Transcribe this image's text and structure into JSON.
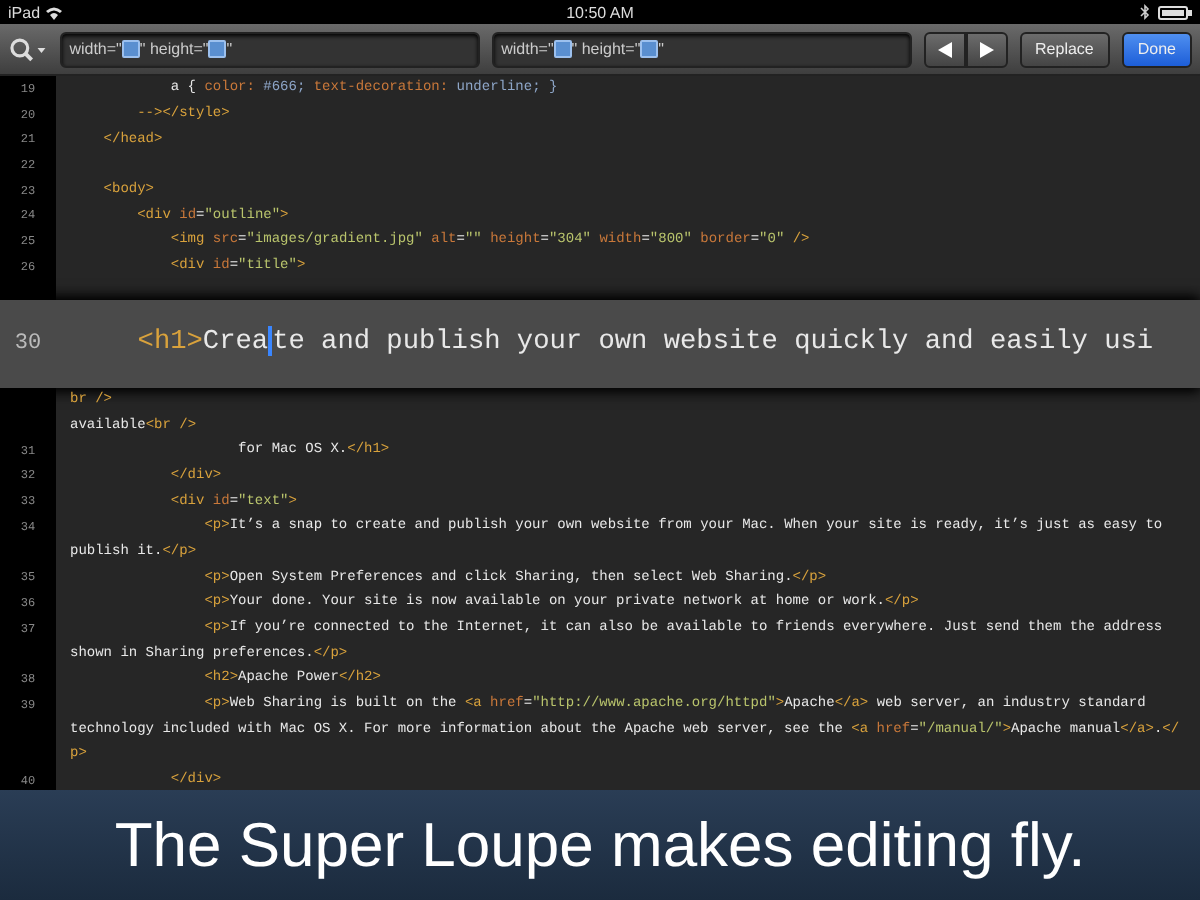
{
  "status_bar": {
    "device": "iPad",
    "time": "10:50 AM"
  },
  "toolbar": {
    "find_field": {
      "segments": [
        {
          "kind": "text",
          "text": "width=\""
        },
        {
          "kind": "token"
        },
        {
          "kind": "text",
          "text": "\" height=\""
        },
        {
          "kind": "token"
        },
        {
          "kind": "text",
          "text": "\""
        }
      ]
    },
    "replace_field": {
      "segments": [
        {
          "kind": "text",
          "text": "width=\""
        },
        {
          "kind": "token"
        },
        {
          "kind": "text",
          "text": "\" height=\""
        },
        {
          "kind": "token"
        },
        {
          "kind": "text",
          "text": "\""
        }
      ]
    },
    "replace_button": "Replace",
    "done_button": "Done"
  },
  "editor": {
    "lines_before": [
      {
        "number": "19",
        "segments": [
          {
            "kind": "text",
            "text": "            a { "
          },
          {
            "kind": "attr",
            "text": "color:"
          },
          {
            "kind": "value",
            "text": " #666; "
          },
          {
            "kind": "attr",
            "text": "text-decoration:"
          },
          {
            "kind": "value",
            "text": " underline; }"
          }
        ]
      },
      {
        "number": "20",
        "segments": [
          {
            "kind": "tag",
            "text": "        --></style>"
          }
        ]
      },
      {
        "number": "21",
        "segments": [
          {
            "kind": "tag",
            "text": "    </head>"
          }
        ]
      },
      {
        "number": "22"
      },
      {
        "number": "23",
        "segments": [
          {
            "kind": "tag",
            "text": "    <body>"
          }
        ]
      },
      {
        "number": "24",
        "segments": [
          {
            "kind": "tag",
            "text": "        <div"
          },
          {
            "kind": "attr",
            "text": " id"
          },
          {
            "kind": "text",
            "text": "="
          },
          {
            "kind": "string",
            "text": "\"outline\""
          },
          {
            "kind": "tag",
            "text": ">"
          }
        ]
      },
      {
        "number": "25",
        "segments": [
          {
            "kind": "tag",
            "text": "            <img"
          },
          {
            "kind": "attr",
            "text": " src"
          },
          {
            "kind": "text",
            "text": "="
          },
          {
            "kind": "string",
            "text": "\"images/gradient.jpg\""
          },
          {
            "kind": "attr",
            "text": " alt"
          },
          {
            "kind": "text",
            "text": "="
          },
          {
            "kind": "string",
            "text": "\"\""
          },
          {
            "kind": "attr",
            "text": " height"
          },
          {
            "kind": "text",
            "text": "="
          },
          {
            "kind": "string",
            "text": "\"304\""
          },
          {
            "kind": "attr",
            "text": " width"
          },
          {
            "kind": "text",
            "text": "="
          },
          {
            "kind": "string",
            "text": "\"800\""
          },
          {
            "kind": "attr",
            "text": " border"
          },
          {
            "kind": "text",
            "text": "="
          },
          {
            "kind": "string",
            "text": "\"0\""
          },
          {
            "kind": "tag",
            "text": " />"
          }
        ]
      },
      {
        "number": "26",
        "segments": [
          {
            "kind": "tag",
            "text": "            <div"
          },
          {
            "kind": "attr",
            "text": " id"
          },
          {
            "kind": "text",
            "text": "="
          },
          {
            "kind": "string",
            "text": "\"title\""
          },
          {
            "kind": "tag",
            "text": ">"
          }
        ]
      }
    ],
    "loupe": {
      "number": "30",
      "segments": [
        {
          "kind": "tag",
          "text": "     <h1>"
        },
        {
          "kind": "text",
          "text": "Crea"
        },
        {
          "kind": "caret"
        },
        {
          "kind": "text",
          "text": "te and publish your own website quickly and easily usi"
        }
      ]
    },
    "lines_after": [
      {
        "segments": [
          {
            "kind": "tag",
            "text": "br />"
          }
        ]
      },
      {
        "segments": [
          {
            "kind": "text",
            "text": "available"
          },
          {
            "kind": "tag",
            "text": "<br />"
          }
        ]
      },
      {
        "number": "31",
        "segments": [
          {
            "kind": "text",
            "text": "                    for Mac OS X."
          },
          {
            "kind": "tag",
            "text": "</h1>"
          }
        ]
      },
      {
        "number": "32",
        "segments": [
          {
            "kind": "tag",
            "text": "            </div>"
          }
        ]
      },
      {
        "number": "33",
        "segments": [
          {
            "kind": "tag",
            "text": "            <div"
          },
          {
            "kind": "attr",
            "text": " id"
          },
          {
            "kind": "text",
            "text": "="
          },
          {
            "kind": "string",
            "text": "\"text\""
          },
          {
            "kind": "tag",
            "text": ">"
          }
        ]
      },
      {
        "number": "34",
        "segments": [
          {
            "kind": "tag",
            "text": "                <p>"
          },
          {
            "kind": "text",
            "text": "It’s a snap to create and publish your own website from your Mac. When your site is ready, it’s just as easy to"
          }
        ]
      },
      {
        "segments": [
          {
            "kind": "text",
            "text": "publish it."
          },
          {
            "kind": "tag",
            "text": "</p>"
          }
        ]
      },
      {
        "number": "35",
        "segments": [
          {
            "kind": "tag",
            "text": "                <p>"
          },
          {
            "kind": "text",
            "text": "Open System Preferences and click Sharing, then select Web Sharing."
          },
          {
            "kind": "tag",
            "text": "</p>"
          }
        ]
      },
      {
        "number": "36",
        "segments": [
          {
            "kind": "tag",
            "text": "                <p>"
          },
          {
            "kind": "text",
            "text": "Your done. Your site is now available on your private network at home or work."
          },
          {
            "kind": "tag",
            "text": "</p>"
          }
        ]
      },
      {
        "number": "37",
        "segments": [
          {
            "kind": "tag",
            "text": "                <p>"
          },
          {
            "kind": "text",
            "text": "If you’re connected to the Internet, it can also be available to friends everywhere. Just send them the address"
          }
        ]
      },
      {
        "segments": [
          {
            "kind": "text",
            "text": "shown in Sharing preferences."
          },
          {
            "kind": "tag",
            "text": "</p>"
          }
        ]
      },
      {
        "number": "38",
        "segments": [
          {
            "kind": "tag",
            "text": "                <h2>"
          },
          {
            "kind": "text",
            "text": "Apache Power"
          },
          {
            "kind": "tag",
            "text": "</h2>"
          }
        ]
      },
      {
        "number": "39",
        "segments": [
          {
            "kind": "tag",
            "text": "                <p>"
          },
          {
            "kind": "text",
            "text": "Web Sharing is built on the "
          },
          {
            "kind": "tag",
            "text": "<a"
          },
          {
            "kind": "attr",
            "text": " href"
          },
          {
            "kind": "text",
            "text": "="
          },
          {
            "kind": "string",
            "text": "\"http://www.apache.org/httpd\""
          },
          {
            "kind": "tag",
            "text": ">"
          },
          {
            "kind": "text",
            "text": "Apache"
          },
          {
            "kind": "tag",
            "text": "</a>"
          },
          {
            "kind": "text",
            "text": " web server, an industry standard"
          }
        ]
      },
      {
        "segments": [
          {
            "kind": "text",
            "text": "technology included with Mac OS X. For more information about the Apache web server, see the "
          },
          {
            "kind": "tag",
            "text": "<a"
          },
          {
            "kind": "attr",
            "text": " href"
          },
          {
            "kind": "text",
            "text": "="
          },
          {
            "kind": "string",
            "text": "\"/manual/\""
          },
          {
            "kind": "tag",
            "text": ">"
          },
          {
            "kind": "text",
            "text": "Apache manual"
          },
          {
            "kind": "tag",
            "text": "</a>"
          },
          {
            "kind": "text",
            "text": "."
          },
          {
            "kind": "tag",
            "text": "</"
          }
        ]
      },
      {
        "segments": [
          {
            "kind": "tag",
            "text": "p>"
          }
        ]
      },
      {
        "number": "40",
        "segments": [
          {
            "kind": "tag",
            "text": "            </div>"
          }
        ]
      }
    ]
  },
  "caption": "The Super Loupe makes editing fly."
}
